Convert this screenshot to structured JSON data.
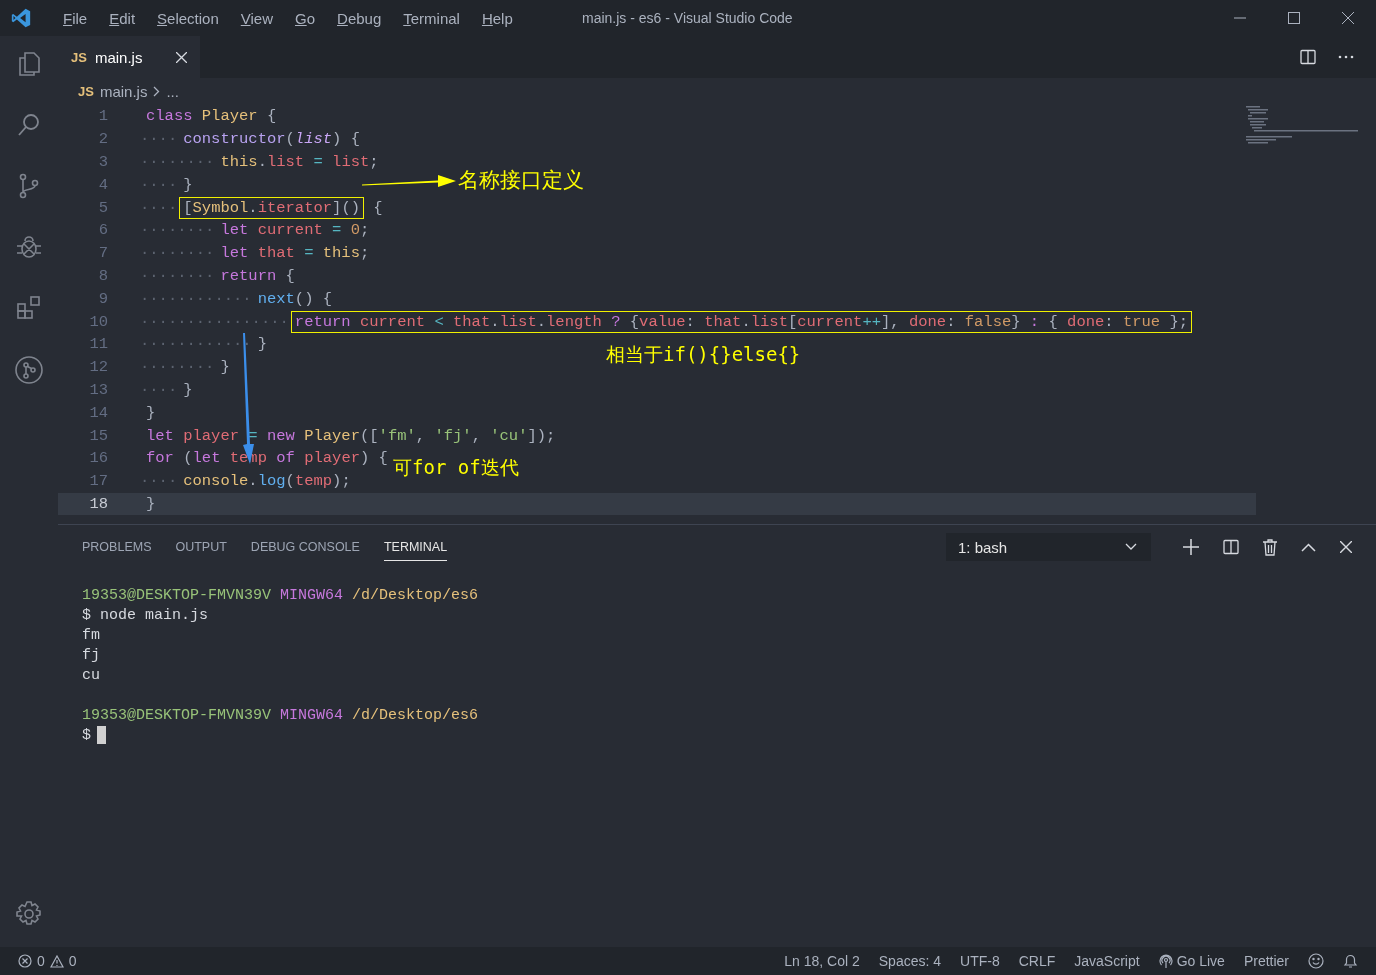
{
  "window": {
    "title": "main.js - es6 - Visual Studio Code"
  },
  "menu": [
    "File",
    "Edit",
    "Selection",
    "View",
    "Go",
    "Debug",
    "Terminal",
    "Help"
  ],
  "tabs": [
    {
      "icon_label": "JS",
      "label": "main.js",
      "selected": true
    }
  ],
  "breadcrumb": {
    "icon_label": "JS",
    "file": "main.js",
    "more": "..."
  },
  "code": [
    {
      "number": "1",
      "current": false,
      "boxed": false,
      "tokens": [
        {
          "kind": "keyword",
          "text": "class "
        },
        {
          "kind": "class",
          "text": "Player "
        },
        {
          "kind": "punct",
          "text": "{"
        }
      ]
    },
    {
      "number": "2",
      "indent": "····",
      "current": false,
      "boxed": false,
      "tokens": [
        {
          "kind": "method",
          "text": "constructor"
        },
        {
          "kind": "punct",
          "text": "("
        },
        {
          "kind": "param",
          "text": "list"
        },
        {
          "kind": "punct",
          "text": ") {"
        }
      ]
    },
    {
      "number": "3",
      "indent": "········",
      "current": false,
      "boxed": false,
      "tokens": [
        {
          "kind": "this",
          "text": "this"
        },
        {
          "kind": "punct",
          "text": "."
        },
        {
          "kind": "prop",
          "text": "list"
        },
        {
          "kind": "op",
          "text": " = "
        },
        {
          "kind": "var",
          "text": "list"
        },
        {
          "kind": "punct",
          "text": ";"
        }
      ]
    },
    {
      "number": "4",
      "indent": "····",
      "current": false,
      "boxed": false,
      "tokens": [
        {
          "kind": "punct",
          "text": "}"
        }
      ]
    },
    {
      "number": "5",
      "indent": "····",
      "current": false,
      "boxed": true,
      "tokens": [
        {
          "kind": "punct",
          "text": "["
        },
        {
          "kind": "class",
          "text": "Symbol"
        },
        {
          "kind": "punct",
          "text": "."
        },
        {
          "kind": "prop",
          "text": "iterator"
        },
        {
          "kind": "punct",
          "text": "]()"
        }
      ],
      "rest": [
        {
          "kind": "punct",
          "text": " {"
        }
      ]
    },
    {
      "number": "6",
      "indent": "········",
      "current": false,
      "boxed": false,
      "tokens": [
        {
          "kind": "keyword",
          "text": "let "
        },
        {
          "kind": "var",
          "text": "current"
        },
        {
          "kind": "op",
          "text": " = "
        },
        {
          "kind": "number",
          "text": "0"
        },
        {
          "kind": "punct",
          "text": ";"
        }
      ]
    },
    {
      "number": "7",
      "indent": "········",
      "current": false,
      "boxed": false,
      "tokens": [
        {
          "kind": "keyword",
          "text": "let "
        },
        {
          "kind": "var",
          "text": "that"
        },
        {
          "kind": "op",
          "text": " = "
        },
        {
          "kind": "this",
          "text": "this"
        },
        {
          "kind": "punct",
          "text": ";"
        }
      ]
    },
    {
      "number": "8",
      "indent": "········",
      "current": false,
      "boxed": false,
      "tokens": [
        {
          "kind": "keyword",
          "text": "return "
        },
        {
          "kind": "punct",
          "text": "{"
        }
      ]
    },
    {
      "number": "9",
      "indent": "············",
      "current": false,
      "boxed": false,
      "tokens": [
        {
          "kind": "func",
          "text": "next"
        },
        {
          "kind": "punct",
          "text": "() {"
        }
      ]
    },
    {
      "number": "10",
      "indent": "················",
      "current": false,
      "boxed": true,
      "tokens": [
        {
          "kind": "keyword",
          "text": "return "
        },
        {
          "kind": "var",
          "text": "current"
        },
        {
          "kind": "op",
          "text": " < "
        },
        {
          "kind": "var",
          "text": "that"
        },
        {
          "kind": "punct",
          "text": "."
        },
        {
          "kind": "prop",
          "text": "list"
        },
        {
          "kind": "punct",
          "text": "."
        },
        {
          "kind": "prop",
          "text": "length"
        },
        {
          "kind": "keyword",
          "text": " ? "
        },
        {
          "kind": "punct",
          "text": "{"
        },
        {
          "kind": "prop",
          "text": "value"
        },
        {
          "kind": "punct",
          "text": ": "
        },
        {
          "kind": "var",
          "text": "that"
        },
        {
          "kind": "punct",
          "text": "."
        },
        {
          "kind": "prop",
          "text": "list"
        },
        {
          "kind": "punct",
          "text": "["
        },
        {
          "kind": "var",
          "text": "current"
        },
        {
          "kind": "op",
          "text": "++"
        },
        {
          "kind": "punct",
          "text": "], "
        },
        {
          "kind": "prop",
          "text": "done"
        },
        {
          "kind": "punct",
          "text": ": "
        },
        {
          "kind": "number",
          "text": "false"
        },
        {
          "kind": "punct",
          "text": "}"
        },
        {
          "kind": "keyword",
          "text": " : "
        },
        {
          "kind": "punct",
          "text": "{ "
        },
        {
          "kind": "prop",
          "text": "done"
        },
        {
          "kind": "punct",
          "text": ": "
        },
        {
          "kind": "number",
          "text": "true"
        },
        {
          "kind": "punct",
          "text": " };"
        }
      ]
    },
    {
      "number": "11",
      "indent": "············",
      "current": false,
      "boxed": false,
      "tokens": [
        {
          "kind": "punct",
          "text": "}"
        }
      ]
    },
    {
      "number": "12",
      "indent": "········",
      "current": false,
      "boxed": false,
      "tokens": [
        {
          "kind": "punct",
          "text": "}"
        }
      ]
    },
    {
      "number": "13",
      "indent": "····",
      "current": false,
      "boxed": false,
      "tokens": [
        {
          "kind": "punct",
          "text": "}"
        }
      ]
    },
    {
      "number": "14",
      "current": false,
      "boxed": false,
      "tokens": [
        {
          "kind": "punct",
          "text": "}"
        }
      ]
    },
    {
      "number": "15",
      "current": false,
      "boxed": false,
      "tokens": [
        {
          "kind": "keyword",
          "text": "let "
        },
        {
          "kind": "var",
          "text": "player"
        },
        {
          "kind": "op",
          "text": " = "
        },
        {
          "kind": "keyword",
          "text": "new "
        },
        {
          "kind": "class",
          "text": "Player"
        },
        {
          "kind": "punct",
          "text": "(["
        },
        {
          "kind": "string",
          "text": "'fm'"
        },
        {
          "kind": "punct",
          "text": ", "
        },
        {
          "kind": "string",
          "text": "'fj'"
        },
        {
          "kind": "punct",
          "text": ", "
        },
        {
          "kind": "string",
          "text": "'cu'"
        },
        {
          "kind": "punct",
          "text": "]);"
        }
      ]
    },
    {
      "number": "16",
      "current": false,
      "boxed": false,
      "tokens": [
        {
          "kind": "keyword",
          "text": "for "
        },
        {
          "kind": "punct",
          "text": "("
        },
        {
          "kind": "keyword",
          "text": "let "
        },
        {
          "kind": "var",
          "text": "temp"
        },
        {
          "kind": "keyword",
          "text": " of "
        },
        {
          "kind": "var",
          "text": "player"
        },
        {
          "kind": "punct",
          "text": ") {"
        }
      ]
    },
    {
      "number": "17",
      "indent": "····",
      "current": false,
      "boxed": false,
      "tokens": [
        {
          "kind": "class",
          "text": "console"
        },
        {
          "kind": "punct",
          "text": "."
        },
        {
          "kind": "func",
          "text": "log"
        },
        {
          "kind": "punct",
          "text": "("
        },
        {
          "kind": "var",
          "text": "temp"
        },
        {
          "kind": "punct",
          "text": ");"
        }
      ]
    },
    {
      "number": "18",
      "current": true,
      "boxed": false,
      "tokens": [
        {
          "kind": "punct",
          "text": "}"
        }
      ]
    }
  ],
  "annotations": [
    {
      "text": "名称接口定义",
      "color": "#ffff00"
    },
    {
      "text": "相当于if(){}else{}",
      "color": "#ffff00"
    },
    {
      "text": "可for of迭代",
      "color": "#ffff00"
    }
  ],
  "arrows": [
    {
      "color": "#ffff00"
    },
    {
      "color": "#3b8eea"
    }
  ],
  "panel_tabs": [
    {
      "label": "PROBLEMS",
      "selected": false
    },
    {
      "label": "OUTPUT",
      "selected": false
    },
    {
      "label": "DEBUG CONSOLE",
      "selected": false
    },
    {
      "label": "TERMINAL",
      "selected": true
    }
  ],
  "terminal_select": {
    "value": "1: bash"
  },
  "terminal": [
    {
      "cursor": false,
      "segments": [
        {
          "kind": "user",
          "text": "19353@DESKTOP-FMVN39V"
        },
        {
          "kind": "host",
          "text": " MINGW64"
        },
        {
          "kind": "path",
          "text": " /d/Desktop/es6"
        }
      ]
    },
    {
      "cursor": false,
      "segments": [
        {
          "kind": "plain",
          "text": "$ node main.js"
        }
      ]
    },
    {
      "cursor": false,
      "segments": [
        {
          "kind": "plain",
          "text": "fm"
        }
      ]
    },
    {
      "cursor": false,
      "segments": [
        {
          "kind": "plain",
          "text": "fj"
        }
      ]
    },
    {
      "cursor": false,
      "segments": [
        {
          "kind": "plain",
          "text": "cu"
        }
      ]
    },
    {
      "cursor": false
    },
    {
      "cursor": false,
      "segments": [
        {
          "kind": "user",
          "text": "19353@DESKTOP-FMVN39V"
        },
        {
          "kind": "host",
          "text": " MINGW64"
        },
        {
          "kind": "path",
          "text": " /d/Desktop/es6"
        }
      ]
    },
    {
      "cursor": true,
      "segments": [
        {
          "kind": "plain",
          "text": "$"
        }
      ]
    }
  ],
  "status_bar": {
    "errors": "0",
    "warnings": "0",
    "items": [
      {
        "kind": "text",
        "text": "Ln 18, Col 2"
      },
      {
        "kind": "text",
        "text": "Spaces: 4"
      },
      {
        "kind": "text",
        "text": "UTF-8"
      },
      {
        "kind": "text",
        "text": "CRLF"
      },
      {
        "kind": "text",
        "text": "JavaScript"
      },
      {
        "kind": "live",
        "text": "Go Live"
      },
      {
        "kind": "text",
        "text": "Prettier"
      }
    ]
  }
}
